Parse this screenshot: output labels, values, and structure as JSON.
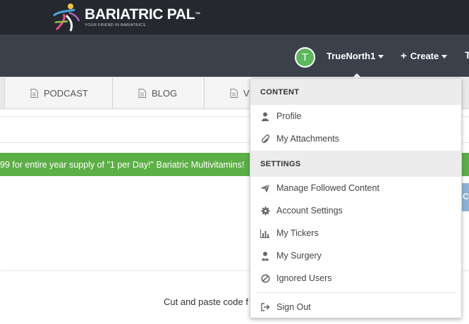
{
  "header": {
    "brand_name": "BARIATRIC PAL",
    "brand_tm": "™",
    "tagline": "YOUR FRIEND IN BARIATRICS"
  },
  "nav": {
    "avatar_initial": "T",
    "username": "TrueNorth1",
    "create_label": "Create",
    "stub_label": "T"
  },
  "tabs": [
    {
      "label": "PODCAST"
    },
    {
      "label": "BLOG"
    },
    {
      "label": "V"
    }
  ],
  "promo": {
    "text": "99 for entire year supply of \"1 per Day!\" Bariatric Multivitamins!"
  },
  "side_button": {
    "label": "C"
  },
  "content": {
    "cut_text": "Cut and paste code f"
  },
  "dropdown": {
    "content_header": "CONTENT",
    "content_items": [
      {
        "label": "Profile",
        "icon": "user-icon"
      },
      {
        "label": "My Attachments",
        "icon": "paperclip-icon"
      }
    ],
    "settings_header": "SETTINGS",
    "settings_items": [
      {
        "label": "Manage Followed Content",
        "icon": "paper-plane-icon"
      },
      {
        "label": "Account Settings",
        "icon": "gear-icon"
      },
      {
        "label": "My Tickers",
        "icon": "bar-chart-icon"
      },
      {
        "label": "My Surgery",
        "icon": "doctor-icon"
      },
      {
        "label": "Ignored Users",
        "icon": "ban-icon"
      }
    ],
    "sign_out": {
      "label": "Sign Out",
      "icon": "sign-out-icon"
    }
  },
  "colors": {
    "header_bg": "#25292f",
    "nav_bg": "#3a414b",
    "avatar": "#5cb85c",
    "promo_bg": "#5cae46"
  }
}
